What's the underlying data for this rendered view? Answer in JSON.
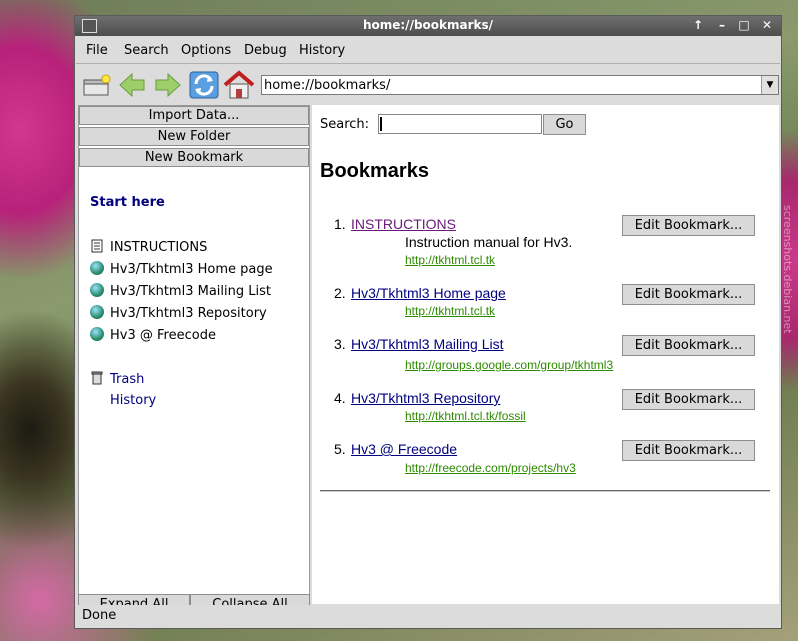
{
  "window": {
    "title": "home://bookmarks/"
  },
  "menubar": [
    "File",
    "Search",
    "Options",
    "Debug",
    "History"
  ],
  "toolbar": {
    "url": "home://bookmarks/"
  },
  "left": {
    "buttons": [
      "Import Data...",
      "New Folder",
      "New Bookmark"
    ],
    "start_here": "Start here",
    "items": [
      "INSTRUCTIONS",
      "Hv3/Tkhtml3 Home page",
      "Hv3/Tkhtml3 Mailing List",
      "Hv3/Tkhtml3 Repository",
      "Hv3 @ Freecode"
    ],
    "trash": "Trash",
    "history": "History",
    "expand_all": "Expand All",
    "collapse_all": "Collapse All"
  },
  "main": {
    "search_label": "Search:",
    "search_value": "",
    "go_label": "Go",
    "heading": "Bookmarks",
    "edit_label": "Edit Bookmark...",
    "bookmarks": [
      {
        "num": "1.",
        "title": "INSTRUCTIONS",
        "desc": "Instruction manual for Hv3.",
        "url": "http://tkhtml.tcl.tk"
      },
      {
        "num": "2.",
        "title": "Hv3/Tkhtml3 Home page",
        "desc": "",
        "url": "http://tkhtml.tcl.tk"
      },
      {
        "num": "3.",
        "title": "Hv3/Tkhtml3 Mailing List",
        "desc": "",
        "url": "http://groups.google.com/group/tkhtml3"
      },
      {
        "num": "4.",
        "title": "Hv3/Tkhtml3 Repository",
        "desc": "",
        "url": "http://tkhtml.tcl.tk/fossil"
      },
      {
        "num": "5.",
        "title": "Hv3 @ Freecode",
        "desc": "",
        "url": "http://freecode.com/projects/hv3"
      }
    ]
  },
  "status": "Done",
  "watermark": "screenshots.debian.net"
}
